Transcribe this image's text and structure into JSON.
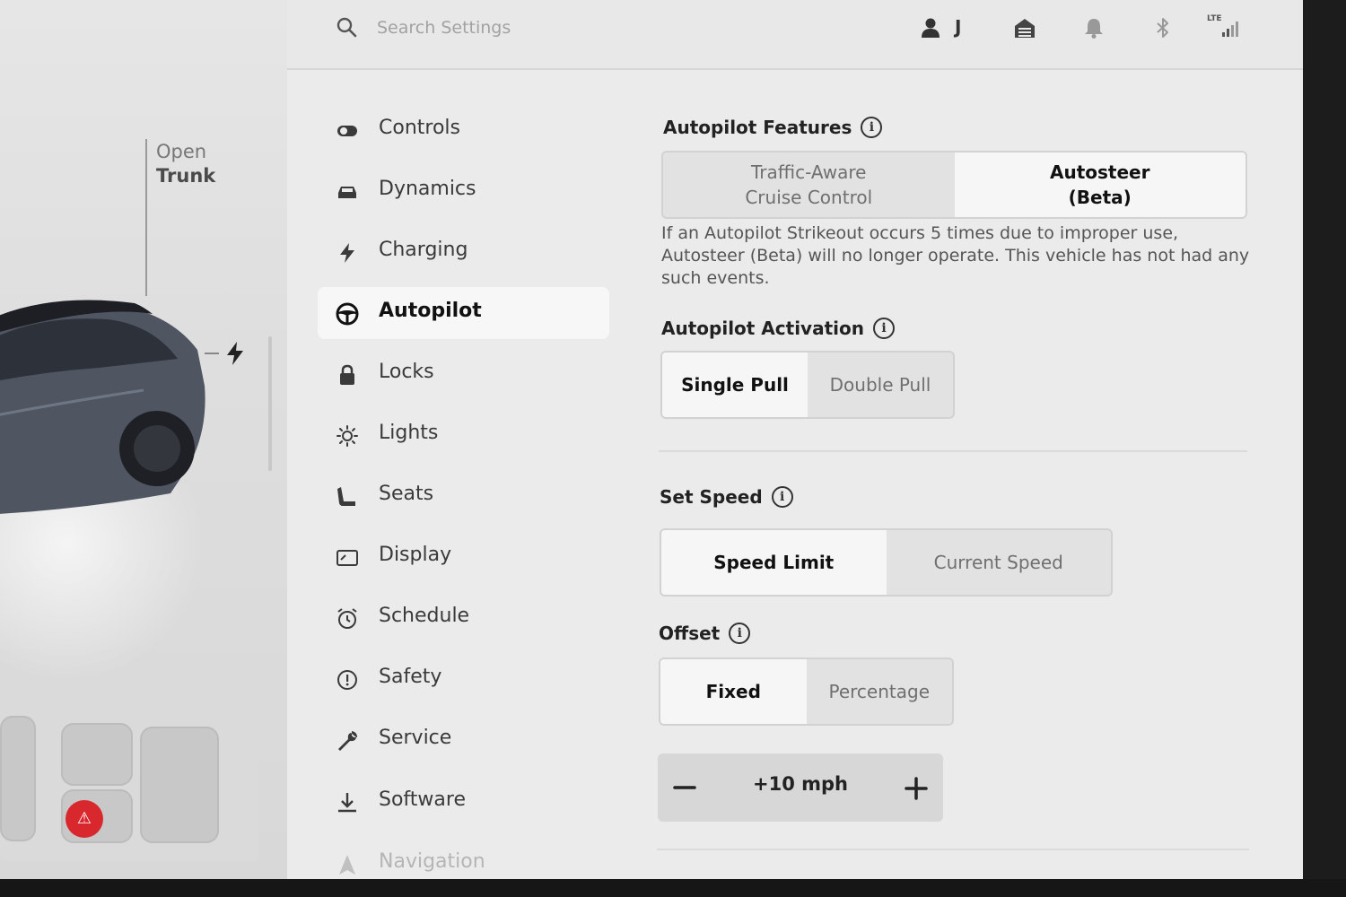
{
  "search": {
    "placeholder": "Search Settings"
  },
  "status_bar": {
    "profile_initial": "J",
    "lte_label": "LTE",
    "icons": [
      "person-icon",
      "garage-icon",
      "bell-icon",
      "bluetooth-icon",
      "signal-icon"
    ]
  },
  "car_panel": {
    "trunk_label_line1": "Open",
    "trunk_label_line2": "Trunk"
  },
  "nav": {
    "items": [
      {
        "label": "Controls",
        "icon": "toggle-icon"
      },
      {
        "label": "Dynamics",
        "icon": "car-icon"
      },
      {
        "label": "Charging",
        "icon": "bolt-icon"
      },
      {
        "label": "Autopilot",
        "icon": "steering-wheel-icon",
        "active": true
      },
      {
        "label": "Locks",
        "icon": "lock-icon"
      },
      {
        "label": "Lights",
        "icon": "sun-icon"
      },
      {
        "label": "Seats",
        "icon": "seat-icon"
      },
      {
        "label": "Display",
        "icon": "display-icon"
      },
      {
        "label": "Schedule",
        "icon": "alarm-icon"
      },
      {
        "label": "Safety",
        "icon": "alert-icon"
      },
      {
        "label": "Service",
        "icon": "wrench-icon"
      },
      {
        "label": "Software",
        "icon": "download-icon"
      },
      {
        "label": "Navigation",
        "icon": "navigation-icon"
      }
    ]
  },
  "autopilot": {
    "features": {
      "title": "Autopilot Features",
      "options": [
        "Traffic-Aware\nCruise Control",
        "Autosteer\n(Beta)"
      ],
      "selected": 1,
      "description": "If an Autopilot Strikeout occurs 5 times due to improper use, Autosteer (Beta) will no longer operate. This vehicle has not had any such events."
    },
    "activation": {
      "title": "Autopilot Activation",
      "options": [
        "Single Pull",
        "Double Pull"
      ],
      "selected": 0
    },
    "set_speed": {
      "title": "Set Speed",
      "options": [
        "Speed Limit",
        "Current Speed"
      ],
      "selected": 0
    },
    "offset": {
      "title": "Offset",
      "options": [
        "Fixed",
        "Percentage"
      ],
      "selected": 0,
      "value": "+10 mph",
      "decrease_label": "−",
      "increase_label": "+"
    }
  },
  "colors": {
    "alert_red": "#d9272e",
    "selected_bg": "#f6f6f6",
    "panel_bg": "#ebebeb"
  }
}
